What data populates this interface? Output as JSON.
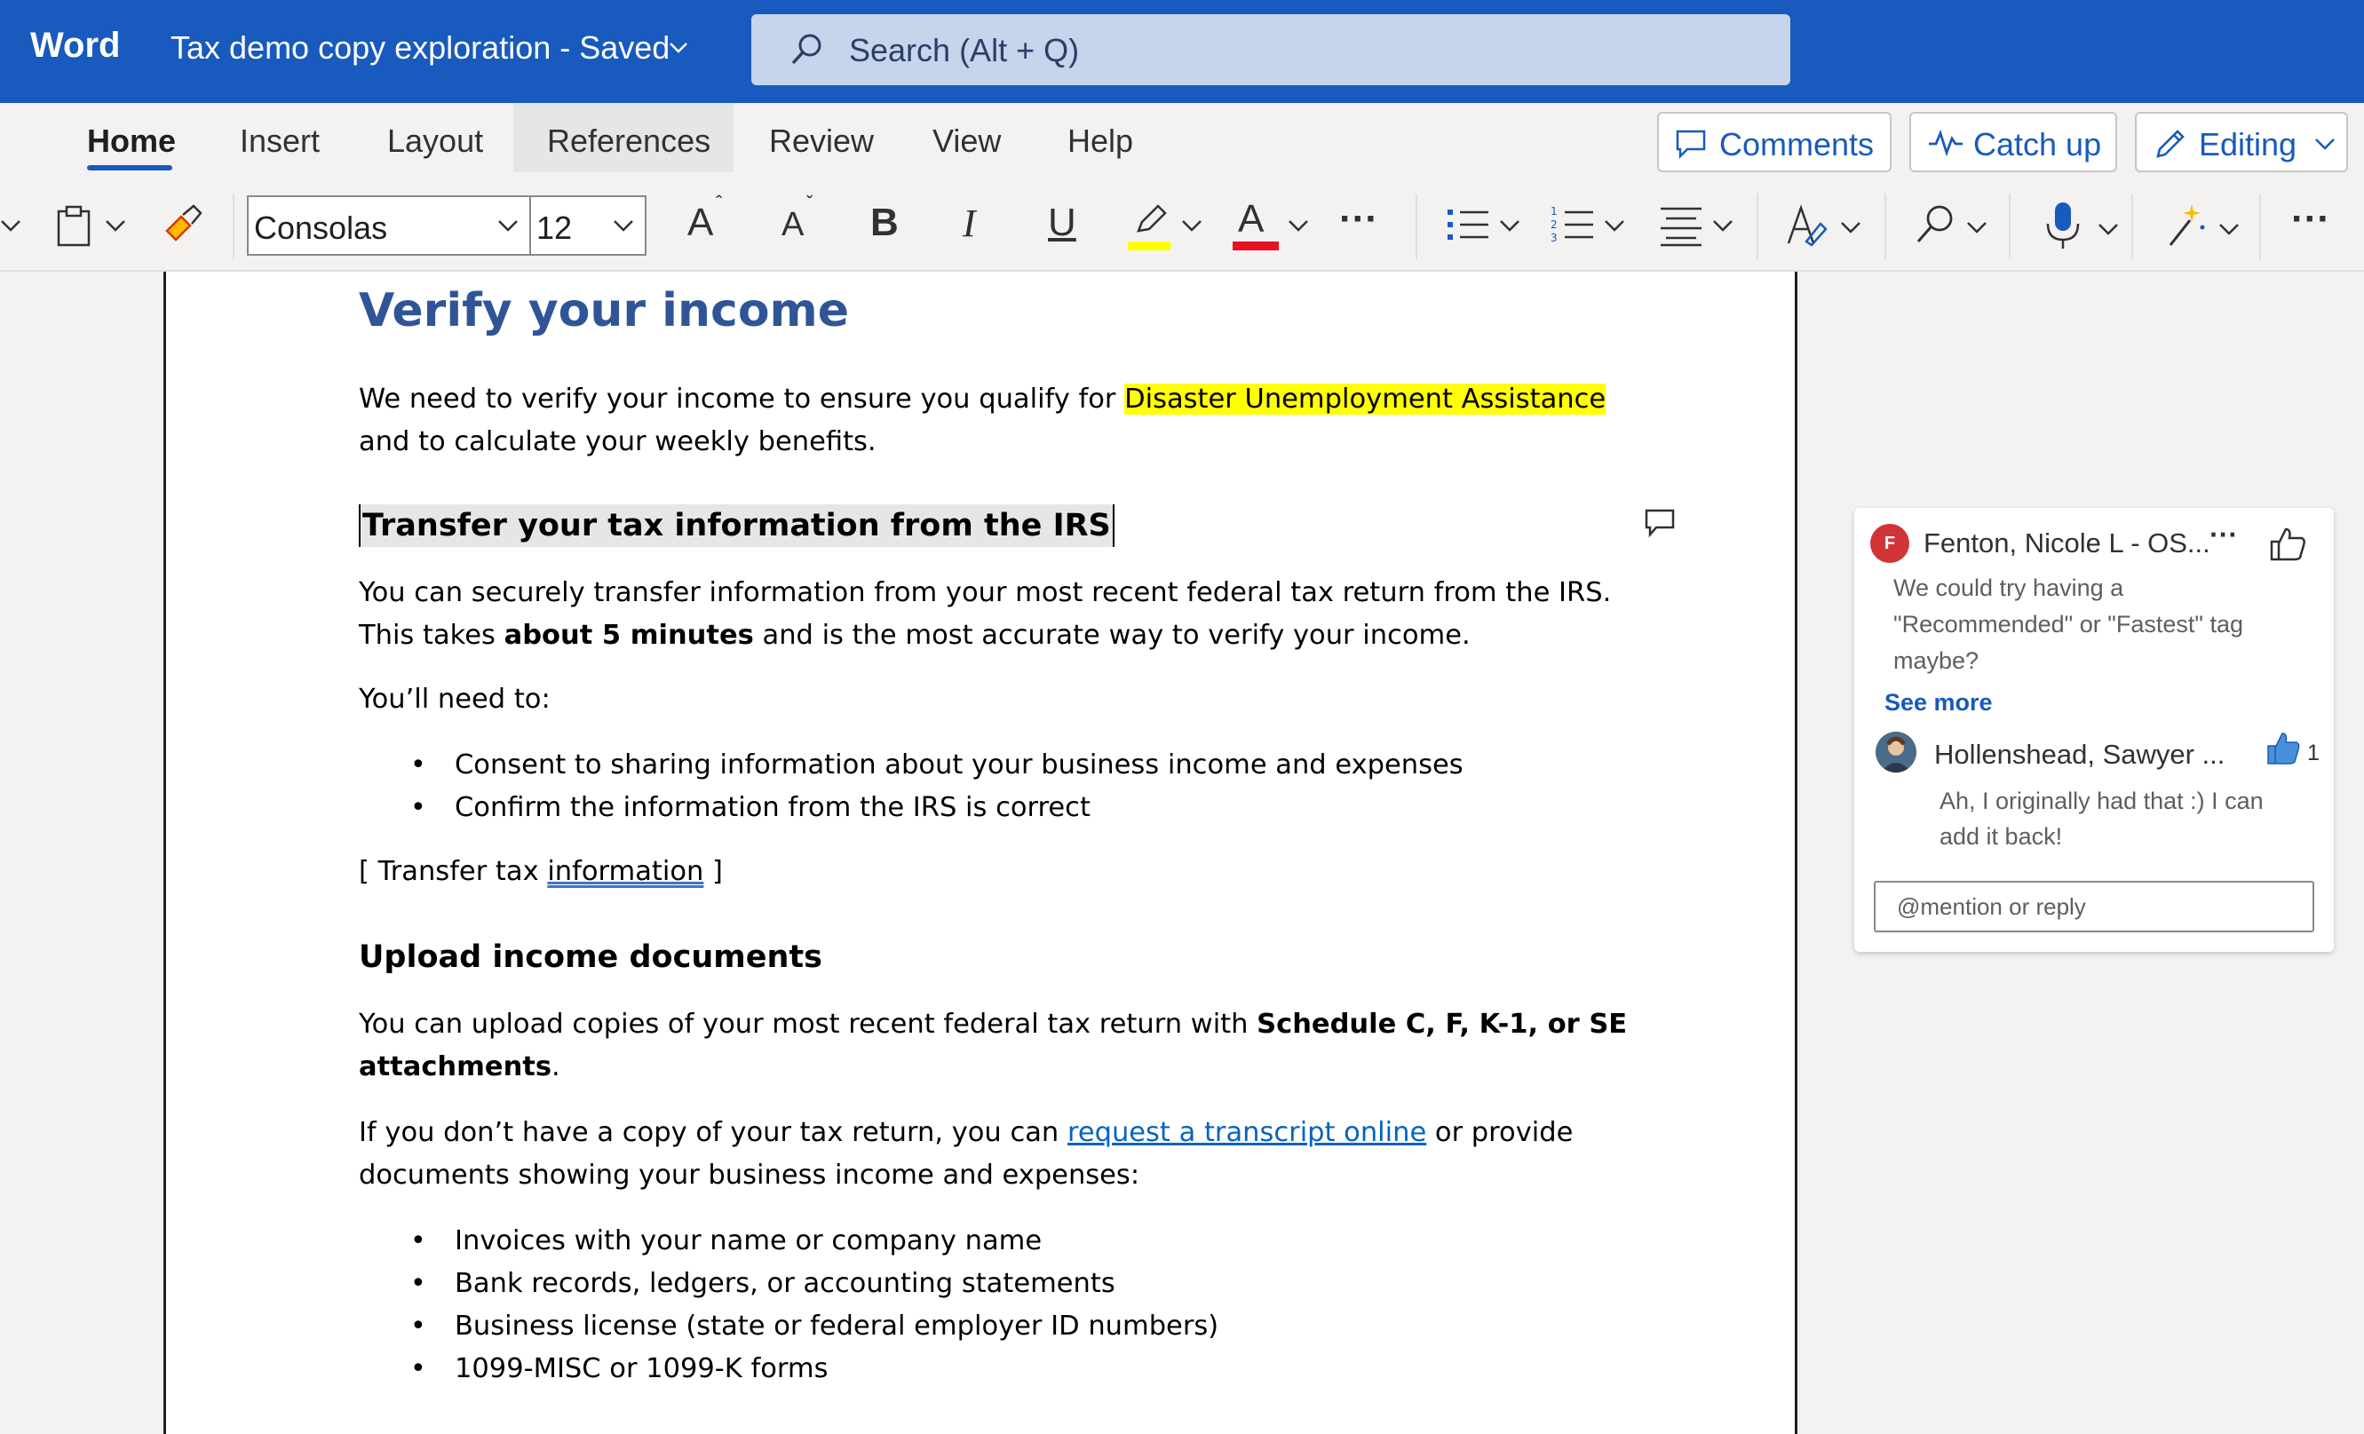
{
  "titlebar": {
    "app_name": "Word",
    "doc_title": "Tax demo copy exploration  -  Saved",
    "search_placeholder": "Search (Alt + Q)"
  },
  "ribbon": {
    "tabs": [
      {
        "label": "Home",
        "active": true
      },
      {
        "label": "Insert"
      },
      {
        "label": "Layout"
      },
      {
        "label": "References"
      },
      {
        "label": "Review"
      },
      {
        "label": "View"
      },
      {
        "label": "Help"
      }
    ],
    "comments_label": "Comments",
    "catchup_label": "Catch up",
    "editing_label": "Editing"
  },
  "toolbar": {
    "font_name": "Consolas",
    "font_size": "12",
    "grow_font": "A",
    "shrink_font": "A",
    "bold": "B",
    "italic": "I",
    "underline": "U",
    "font_color_glyph": "A",
    "more": "···",
    "highlight_color": "#ffff00",
    "font_color": "#e81123"
  },
  "document": {
    "heading1": "Verify your income",
    "intro_before": "We need to verify your income to ensure you qualify for ",
    "intro_highlight": "Disaster Unemployment Assistance",
    "intro_line2": "and to calculate your weekly benefits.",
    "heading_transfer": "Transfer your tax information from the IRS",
    "transfer_line1": "You can securely transfer information from your most recent federal tax return from the IRS.",
    "transfer_line2_a": "This takes ",
    "transfer_line2_bold": "about 5 minutes",
    "transfer_line2_b": " and is the most accurate way to verify your income.",
    "need_to": "You’ll need to:",
    "need_items": [
      "Consent to sharing information about your business income and expenses",
      "Confirm the information from the IRS is correct"
    ],
    "transfer_link_a": "[ Transfer tax ",
    "transfer_link_b": "information",
    "transfer_link_c": " ]",
    "heading_upload": "Upload income documents",
    "upload_line1_a": "You can upload copies of your most recent federal tax return with ",
    "upload_line1_bold": "Schedule C, F, K-1, or SE",
    "upload_line2_bold": "attachments",
    "upload_line2_b": ".",
    "nocopy_a": "If you don’t have a copy of your tax return, you can ",
    "nocopy_link": "request a transcript online",
    "nocopy_b": " or provide",
    "nocopy_line2": "documents showing your business income and expenses:",
    "doc_items": [
      "Invoices with your name or company name",
      "Bank records, ledgers, or accounting statements",
      "Business license (state or federal employer ID numbers)",
      "1099-MISC or 1099-K forms"
    ]
  },
  "comment": {
    "author_initial": "F",
    "author": "Fenton, Nicole L - OS...",
    "text_lines": [
      "We could try having a",
      "\"Recommended\" or \"Fastest\" tag",
      "maybe?"
    ],
    "see_more": "See more",
    "reply_author": "Hollenshead, Sawyer ...",
    "reply_likes": "1",
    "reply_lines": [
      "Ah, I originally had that :) I can",
      "add it back!"
    ],
    "reply_placeholder": "@mention or reply",
    "avatar_color": "#d13438"
  }
}
